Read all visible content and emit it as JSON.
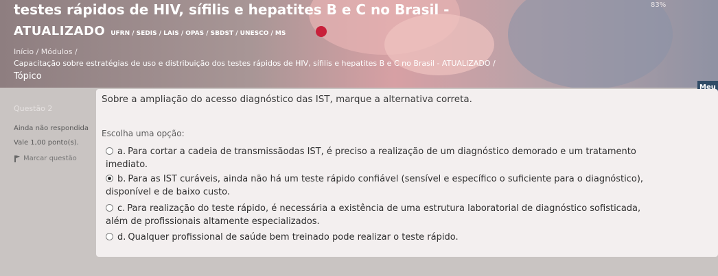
{
  "header": {
    "course_title": "testes rápidos de HIV, sífilis e hepatites B e C no Brasil -",
    "percent": "83%",
    "subtitle": "ATUALIZADO",
    "orgs": "UFRN / SEDIS / LAIS / OPAS / SBDST / UNESCO / MS",
    "breadcrumb_1": "Início / Módulos /",
    "breadcrumb_2": "Capacitação sobre estratégias de uso e distribuição dos testes rápidos de HIV, sífilis e hepatites B e C no Brasil - ATUALIZADO /",
    "section": "Tópico",
    "menu_label": "Meu"
  },
  "sidebar": {
    "question_number": "Questão 2",
    "status": "Ainda não respondida",
    "grade": "Vale 1,00 ponto(s).",
    "flag_label": "Marcar questão"
  },
  "question": {
    "text": "Sobre a ampliação do acesso diagnóstico das IST, marque a alternativa correta.",
    "prompt": "Escolha uma opção:",
    "options": [
      {
        "letter": "a.",
        "line1": "Para cortar a cadeia de transmissãodas IST, é preciso a realização de um diagnóstico demorado e um tratamento",
        "line2": "imediato."
      },
      {
        "letter": "b.",
        "line1": "Para as IST curáveis, ainda não há um teste rápido confiável (sensível e específico o suficiente para o diagnóstico),",
        "line2": "disponível e de baixo custo."
      },
      {
        "letter": "c.",
        "line1": "Para realização do teste rápido, é necessária a existência de uma estrutura laboratorial de diagnóstico sofisticada,",
        "line2": "além de profissionais altamente especializados."
      },
      {
        "letter": "d.",
        "line1": "Qualquer profissional de saúde bem treinado pode realizar o teste rápido.",
        "line2": ""
      }
    ],
    "selected": "b."
  }
}
